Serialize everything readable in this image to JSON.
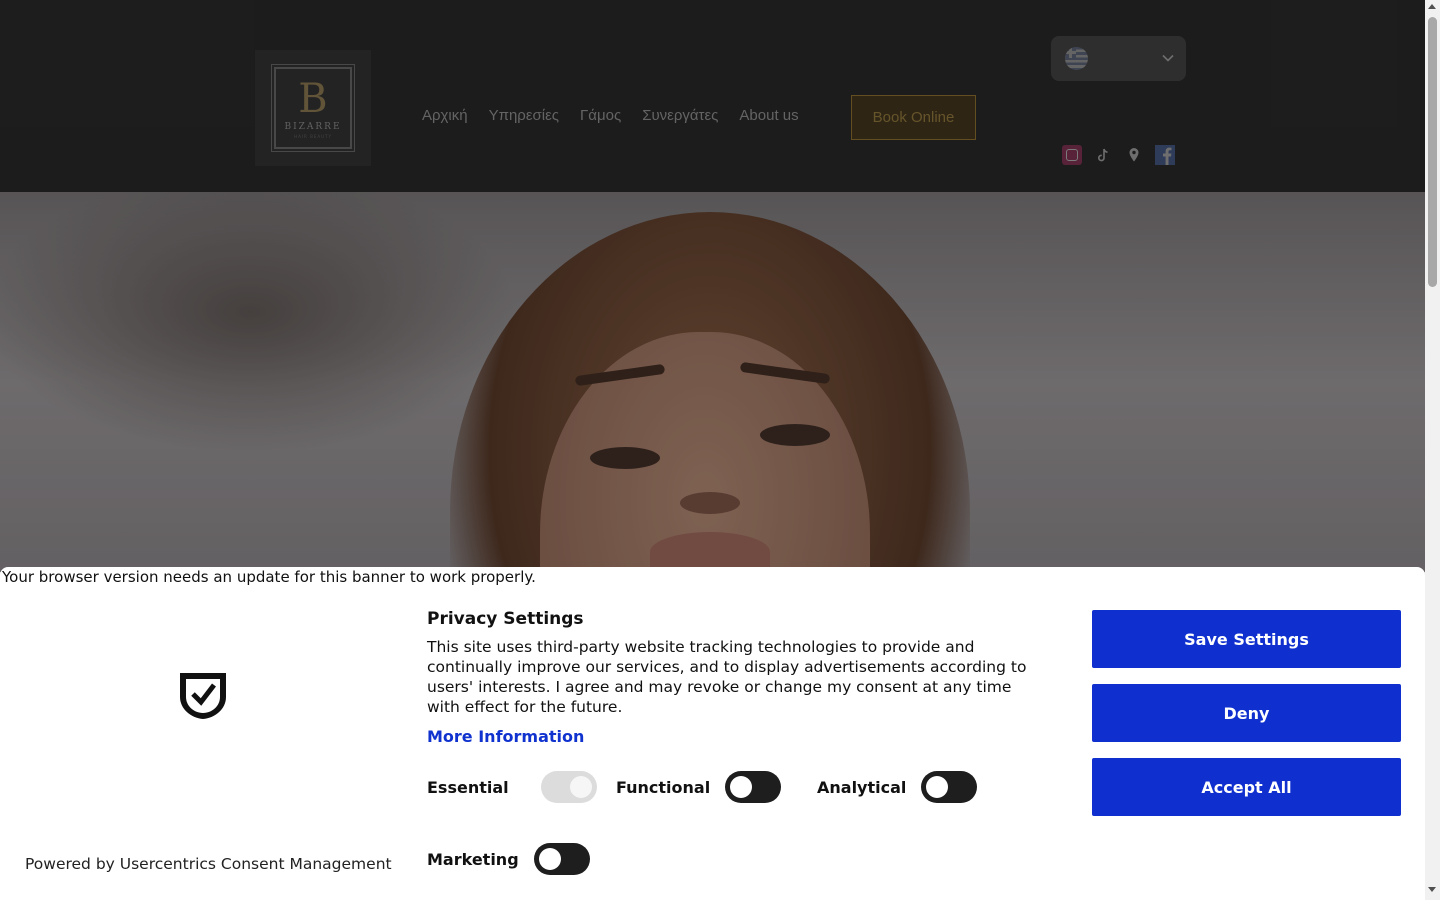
{
  "header": {
    "logo": {
      "letter": "B",
      "name": "BIZARRE",
      "sub": "HAIR BEAUTY"
    },
    "nav": [
      {
        "label": "Αρχική"
      },
      {
        "label": "Υπηρεσίες"
      },
      {
        "label": "Γάμος"
      },
      {
        "label": "Συνεργάτες"
      },
      {
        "label": "About us"
      }
    ],
    "book_label": "Book Online",
    "language_icon": "greek-flag-icon",
    "social_icons": [
      "instagram-icon",
      "tiktok-icon",
      "map-pin-icon",
      "facebook-icon"
    ]
  },
  "banner": {
    "update_note": "Your browser version needs an update for this banner to work properly.",
    "title": "Privacy Settings",
    "description": "This site uses third-party website tracking technologies to provide and continually improve our services, and to display advertisements according to users' interests. I agree and may revoke or change my consent at any time with effect for the future.",
    "more_info": "More Information",
    "toggles": {
      "essential": "Essential",
      "functional": "Functional",
      "analytical": "Analytical",
      "marketing": "Marketing"
    },
    "buttons": {
      "save": "Save Settings",
      "deny": "Deny",
      "accept": "Accept All"
    },
    "powered_by": "Powered by Usercentrics Consent Management",
    "colors": {
      "primary": "#0f2fcf",
      "toggle_off": "#1e1e1e"
    }
  }
}
